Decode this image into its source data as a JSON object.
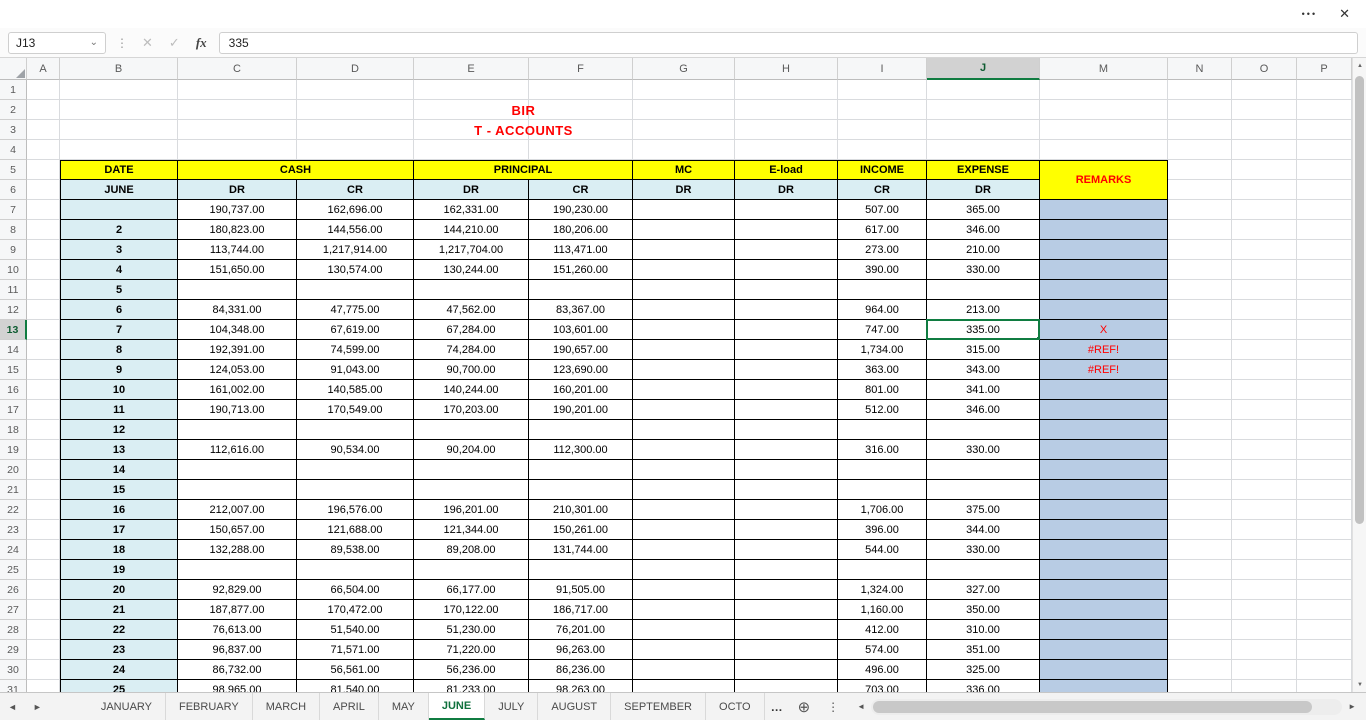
{
  "window": {
    "more": "•••",
    "close": "✕"
  },
  "formula_bar": {
    "name_box": "J13",
    "dropdown": "⌄",
    "divider": "⋮",
    "cancel": "✕",
    "confirm": "✓",
    "fx": "fx",
    "value": "335"
  },
  "sheet": {
    "columns": [
      "A",
      "B",
      "C",
      "D",
      "E",
      "F",
      "G",
      "H",
      "I",
      "J",
      "M",
      "N",
      "O",
      "P"
    ],
    "row_count": 31,
    "selected_column": "J",
    "selected_row": 13,
    "selected_cell": "J13",
    "title_line1": "BIR",
    "title_line2": "T - ACCOUNTS",
    "header": {
      "date": "DATE",
      "month": "JUNE",
      "cash": "CASH",
      "principal": "PRINCIPAL",
      "mc": "MC",
      "eload": "E-load",
      "income": "INCOME",
      "expense": "EXPENSE",
      "remarks": "REMARKS",
      "dr": "DR",
      "cr": "CR"
    },
    "rows": [
      {
        "r": 7,
        "date": "",
        "c": "190,737.00",
        "d": "162,696.00",
        "e": "162,331.00",
        "f": "190,230.00",
        "i": "507.00",
        "j": "365.00"
      },
      {
        "r": 8,
        "date": "2",
        "c": "180,823.00",
        "d": "144,556.00",
        "e": "144,210.00",
        "f": "180,206.00",
        "i": "617.00",
        "j": "346.00"
      },
      {
        "r": 9,
        "date": "3",
        "c": "113,744.00",
        "d": "1,217,914.00",
        "e": "1,217,704.00",
        "f": "113,471.00",
        "i": "273.00",
        "j": "210.00"
      },
      {
        "r": 10,
        "date": "4",
        "c": "151,650.00",
        "d": "130,574.00",
        "e": "130,244.00",
        "f": "151,260.00",
        "i": "390.00",
        "j": "330.00"
      },
      {
        "r": 11,
        "date": "5"
      },
      {
        "r": 12,
        "date": "6",
        "c": "84,331.00",
        "d": "47,775.00",
        "e": "47,562.00",
        "f": "83,367.00",
        "i": "964.00",
        "j": "213.00"
      },
      {
        "r": 13,
        "date": "7",
        "c": "104,348.00",
        "d": "67,619.00",
        "e": "67,284.00",
        "f": "103,601.00",
        "i": "747.00",
        "j": "335.00",
        "m": "X"
      },
      {
        "r": 14,
        "date": "8",
        "c": "192,391.00",
        "d": "74,599.00",
        "e": "74,284.00",
        "f": "190,657.00",
        "i": "1,734.00",
        "j": "315.00",
        "m": "#REF!"
      },
      {
        "r": 15,
        "date": "9",
        "c": "124,053.00",
        "d": "91,043.00",
        "e": "90,700.00",
        "f": "123,690.00",
        "i": "363.00",
        "j": "343.00",
        "m": "#REF!"
      },
      {
        "r": 16,
        "date": "10",
        "c": "161,002.00",
        "d": "140,585.00",
        "e": "140,244.00",
        "f": "160,201.00",
        "i": "801.00",
        "j": "341.00"
      },
      {
        "r": 17,
        "date": "11",
        "c": "190,713.00",
        "d": "170,549.00",
        "e": "170,203.00",
        "f": "190,201.00",
        "i": "512.00",
        "j": "346.00"
      },
      {
        "r": 18,
        "date": "12"
      },
      {
        "r": 19,
        "date": "13",
        "c": "112,616.00",
        "d": "90,534.00",
        "e": "90,204.00",
        "f": "112,300.00",
        "i": "316.00",
        "j": "330.00"
      },
      {
        "r": 20,
        "date": "14"
      },
      {
        "r": 21,
        "date": "15"
      },
      {
        "r": 22,
        "date": "16",
        "c": "212,007.00",
        "d": "196,576.00",
        "e": "196,201.00",
        "f": "210,301.00",
        "i": "1,706.00",
        "j": "375.00"
      },
      {
        "r": 23,
        "date": "17",
        "c": "150,657.00",
        "d": "121,688.00",
        "e": "121,344.00",
        "f": "150,261.00",
        "i": "396.00",
        "j": "344.00"
      },
      {
        "r": 24,
        "date": "18",
        "c": "132,288.00",
        "d": "89,538.00",
        "e": "89,208.00",
        "f": "131,744.00",
        "i": "544.00",
        "j": "330.00"
      },
      {
        "r": 25,
        "date": "19"
      },
      {
        "r": 26,
        "date": "20",
        "c": "92,829.00",
        "d": "66,504.00",
        "e": "66,177.00",
        "f": "91,505.00",
        "i": "1,324.00",
        "j": "327.00"
      },
      {
        "r": 27,
        "date": "21",
        "c": "187,877.00",
        "d": "170,472.00",
        "e": "170,122.00",
        "f": "186,717.00",
        "i": "1,160.00",
        "j": "350.00"
      },
      {
        "r": 28,
        "date": "22",
        "c": "76,613.00",
        "d": "51,540.00",
        "e": "51,230.00",
        "f": "76,201.00",
        "i": "412.00",
        "j": "310.00"
      },
      {
        "r": 29,
        "date": "23",
        "c": "96,837.00",
        "d": "71,571.00",
        "e": "71,220.00",
        "f": "96,263.00",
        "i": "574.00",
        "j": "351.00"
      },
      {
        "r": 30,
        "date": "24",
        "c": "86,732.00",
        "d": "56,561.00",
        "e": "56,236.00",
        "f": "86,236.00",
        "i": "496.00",
        "j": "325.00"
      },
      {
        "r": 31,
        "date": "25",
        "c": "98,965.00",
        "d": "81,540.00",
        "e": "81,233.00",
        "f": "98,263.00",
        "i": "703.00",
        "j": "336.00"
      }
    ]
  },
  "scrollbar": {
    "up": "▲",
    "down": "▼",
    "left": "◄",
    "right": "►"
  },
  "tabbar": {
    "scroll_left": "◄",
    "scroll_right": "►",
    "tabs": [
      "JANUARY",
      "FEBRUARY",
      "MARCH",
      "APRIL",
      "MAY",
      "JUNE",
      "JULY",
      "AUGUST",
      "SEPTEMBER",
      "OCTO"
    ],
    "active_tab": "JUNE",
    "overflow_ellipsis": "…",
    "add_sheet": "⊕",
    "more": "⋮"
  },
  "colors": {
    "accent_green": "#107C41",
    "header_yellow": "#FFFF00",
    "subheader_cyan": "#DAEEF3",
    "remarks_fill": "#B8CCE4",
    "alert_red": "#FF0000"
  }
}
